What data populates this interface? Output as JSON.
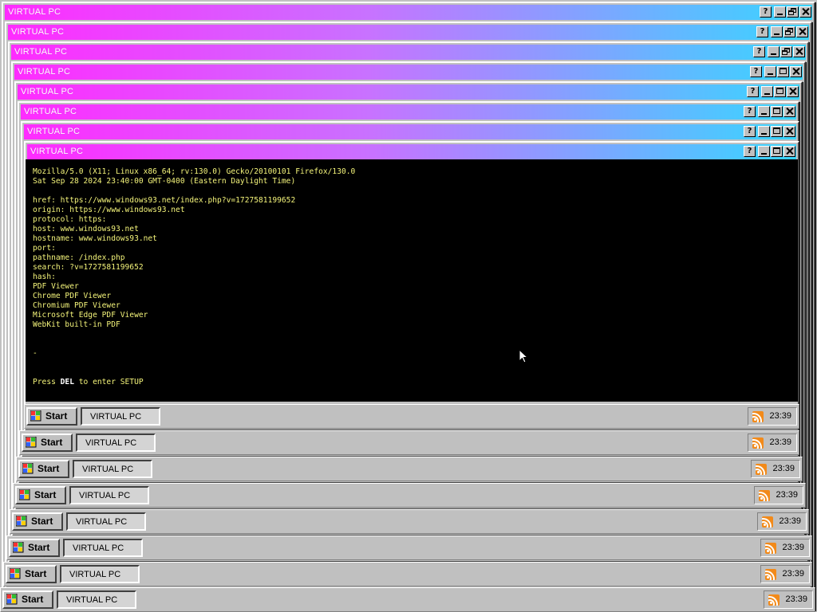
{
  "window_title": "VIRTUAL PC",
  "window_buttons": {
    "help": "?"
  },
  "terminal": {
    "lines": [
      "Mozilla/5.0 (X11; Linux x86_64; rv:130.0) Gecko/20100101 Firefox/130.0",
      "Sat Sep 28 2024 23:40:00 GMT-0400 (Eastern Daylight Time)",
      "",
      "href: https://www.windows93.net/index.php?v=1727581199652",
      "origin: https://www.windows93.net",
      "protocol: https:",
      "host: www.windows93.net",
      "hostname: www.windows93.net",
      "port:",
      "pathname: /index.php",
      "search: ?v=1727581199652",
      "hash:",
      "PDF Viewer",
      "Chrome PDF Viewer",
      "Chromium PDF Viewer",
      "Microsoft Edge PDF Viewer",
      "WebKit built-in PDF",
      "",
      "",
      "-",
      "",
      ""
    ],
    "setup_prefix": "Press ",
    "setup_key": "DEL",
    "setup_suffix": " to enter SETUP"
  },
  "taskbar": {
    "start_label": "Start",
    "task_label": "VIRTUAL PC",
    "clock": "23:39",
    "tray_icon": "rss-icon"
  },
  "colors": {
    "title_gradient_start": "#ff2bff",
    "title_gradient_end": "#37d6ff",
    "terminal_text": "#f4f47a",
    "terminal_bg": "#000000",
    "rss_orange": "#f28a1a"
  }
}
